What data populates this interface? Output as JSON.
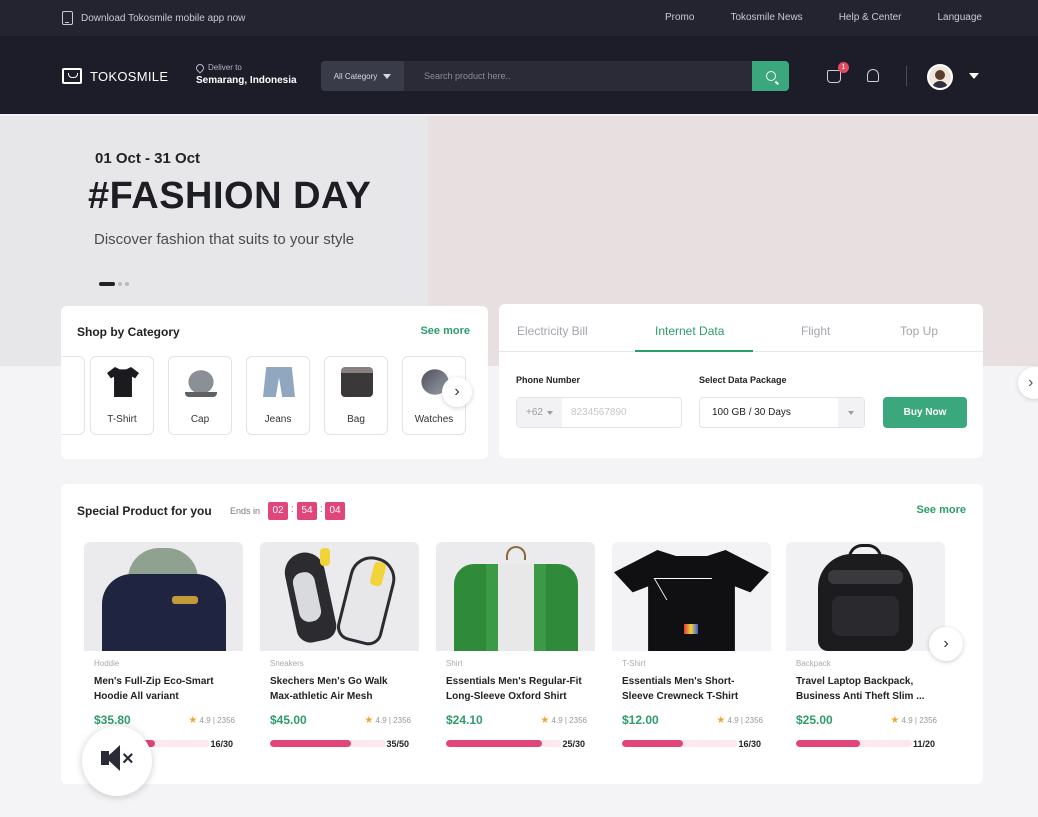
{
  "topbar": {
    "app_text": "Download Tokosmile mobile app now",
    "links": [
      "Promo",
      "Tokosmile News",
      "Help & Center",
      "Language"
    ]
  },
  "header": {
    "brand": "TOKOSMILE",
    "deliver_label": "Deliver to",
    "deliver_value": "Semarang, Indonesia",
    "category_select": "All Category",
    "search_placeholder": "Search product here..",
    "cart_count": "1"
  },
  "hero": {
    "date": "01 Oct - 31 Oct",
    "title": "#FASHION DAY",
    "subtitle": "Discover fashion that suits to your style"
  },
  "categories": {
    "title": "Shop by Category",
    "see_more": "See more",
    "items": [
      "T-Shirt",
      "Cap",
      "Jeans",
      "Bag",
      "Watches"
    ]
  },
  "bills": {
    "tabs": [
      "Electricity Bill",
      "Internet Data",
      "Flight",
      "Top Up"
    ],
    "active_tab": "Internet Data",
    "phone_label": "Phone Number",
    "country_code": "+62",
    "phone_placeholder": "8234567890",
    "package_label": "Select Data Package",
    "package_value": "100 GB / 30 Days",
    "buy_label": "Buy Now"
  },
  "special": {
    "title": "Special Product for you",
    "ends_in": "Ends in",
    "timer": [
      "02",
      "54",
      "04"
    ],
    "see_more": "See more",
    "products": [
      {
        "category": "Hoddie",
        "name": "Men's Full-Zip Eco-Smart Hoodie All variant",
        "price": "$35.80",
        "rating": "4.9 | 2356",
        "stock": "16/30",
        "sold_fraction": 0.53
      },
      {
        "category": "Sneakers",
        "name": "Skechers Men's Go Walk Max-athletic Air Mesh",
        "price": "$45.00",
        "rating": "4.9 | 2356",
        "stock": "35/50",
        "sold_fraction": 0.7
      },
      {
        "category": "Shirt",
        "name": "Essentials Men's Regular-Fit Long-Sleeve Oxford Shirt",
        "price": "$24.10",
        "rating": "4.9 | 2356",
        "stock": "25/30",
        "sold_fraction": 0.83
      },
      {
        "category": "T-Shirt",
        "name": "Essentials Men's Short-Sleeve Crewneck T-Shirt",
        "price": "$12.00",
        "rating": "4.9 | 2356",
        "stock": "16/30",
        "sold_fraction": 0.53
      },
      {
        "category": "Backpack",
        "name": "Travel Laptop Backpack, Business Anti Theft Slim ...",
        "price": "$25.00",
        "rating": "4.9 | 2356",
        "stock": "11/20",
        "sold_fraction": 0.55
      }
    ]
  },
  "colors": {
    "header_bg": "#1c1d29",
    "accent_green": "#3aa77c",
    "accent_pink": "#e0457b"
  }
}
